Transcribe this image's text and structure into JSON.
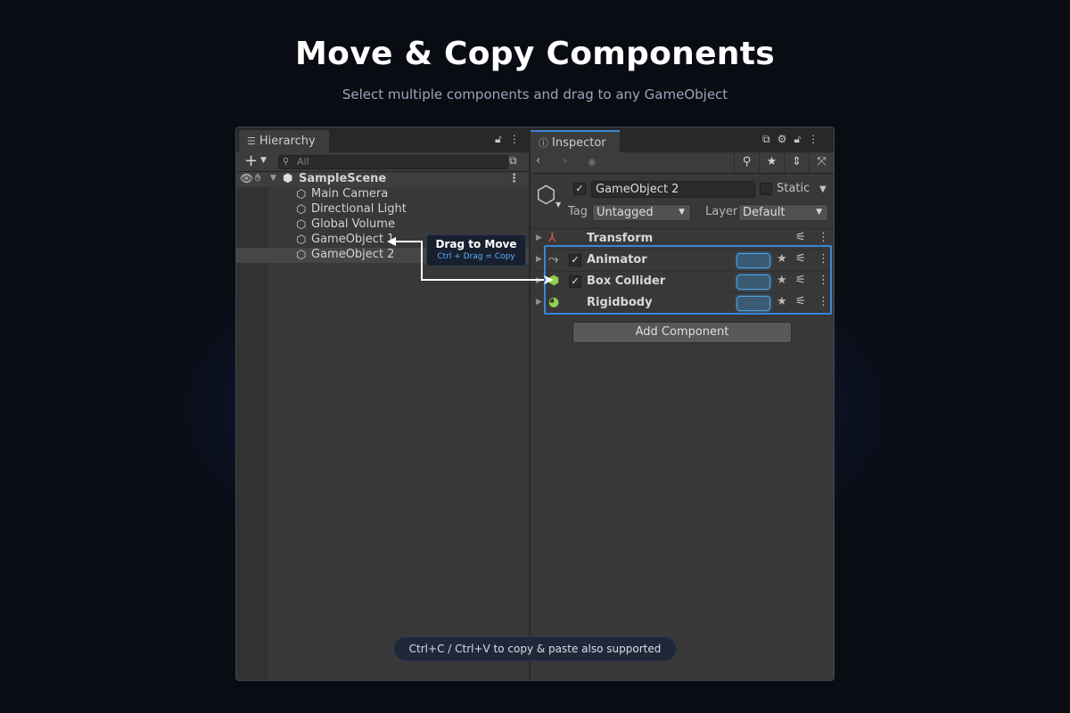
{
  "header": {
    "title": "Move & Copy Components",
    "subtitle": "Select multiple components and drag to any GameObject"
  },
  "hierarchy": {
    "tab_label": "Hierarchy",
    "search_placeholder": "All",
    "scene": "SampleScene",
    "items": [
      {
        "label": "Main Camera"
      },
      {
        "label": "Directional Light"
      },
      {
        "label": "Global Volume"
      },
      {
        "label": "GameObject 1"
      },
      {
        "label": "GameObject 2",
        "selected": true
      }
    ]
  },
  "inspector": {
    "tab_label": "Inspector",
    "object_name": "GameObject 2",
    "static_label": "Static",
    "tag_label": "Tag",
    "tag_value": "Untagged",
    "layer_label": "Layer",
    "layer_value": "Default",
    "components": [
      {
        "name": "Transform",
        "icon": "transform-icon",
        "has_checkbox": false,
        "selected": false
      },
      {
        "name": "Animator",
        "icon": "animator-icon",
        "has_checkbox": true,
        "selected": true
      },
      {
        "name": "Box Collider",
        "icon": "box-collider-icon",
        "has_checkbox": true,
        "selected": true
      },
      {
        "name": "Rigidbody",
        "icon": "rigidbody-icon",
        "has_checkbox": false,
        "selected": true
      }
    ],
    "add_component_label": "Add Component"
  },
  "drag_tooltip": {
    "title": "Drag to Move",
    "subtitle": "Ctrl + Drag = Copy"
  },
  "hint": "Ctrl+C  /  Ctrl+V to copy & paste also supported",
  "colors": {
    "selection_outline": "#3a86d6",
    "tooltip_accent": "#5fb0ff",
    "panel_bg": "#383838",
    "page_bg": "#090c13"
  }
}
